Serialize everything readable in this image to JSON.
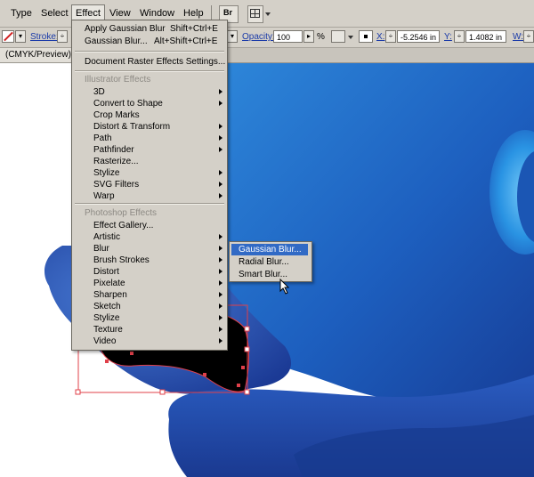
{
  "menubar": {
    "items": [
      "Type",
      "Select",
      "Effect",
      "View",
      "Window",
      "Help"
    ],
    "bridge_label": "Br"
  },
  "controlbar": {
    "stroke_label": "Stroke:",
    "opacity_label": "Opacity:",
    "opacity_value": "100",
    "opacity_unit": "%",
    "x_label": "X:",
    "x_value": "-5.2546 in",
    "y_label": "Y:",
    "y_value": "1.4082 in",
    "w_label": "W:"
  },
  "document": {
    "tab_label": "(CMYK/Preview)"
  },
  "effect_menu": {
    "apply_last": {
      "label": "Apply Gaussian Blur",
      "shortcut": "Shift+Ctrl+E"
    },
    "last_effect": {
      "label": "Gaussian Blur...",
      "shortcut": "Alt+Shift+Ctrl+E"
    },
    "raster_settings": "Document Raster Effects Settings...",
    "illustrator_heading": "Illustrator Effects",
    "illustrator_items": [
      {
        "label": "3D",
        "submenu": true
      },
      {
        "label": "Convert to Shape",
        "submenu": true
      },
      {
        "label": "Crop Marks",
        "submenu": false
      },
      {
        "label": "Distort & Transform",
        "submenu": true
      },
      {
        "label": "Path",
        "submenu": true
      },
      {
        "label": "Pathfinder",
        "submenu": true
      },
      {
        "label": "Rasterize...",
        "submenu": false
      },
      {
        "label": "Stylize",
        "submenu": true
      },
      {
        "label": "SVG Filters",
        "submenu": true
      },
      {
        "label": "Warp",
        "submenu": true
      }
    ],
    "photoshop_heading": "Photoshop Effects",
    "photoshop_items": [
      {
        "label": "Effect Gallery...",
        "submenu": false
      },
      {
        "label": "Artistic",
        "submenu": true
      },
      {
        "label": "Blur",
        "submenu": true
      },
      {
        "label": "Brush Strokes",
        "submenu": true
      },
      {
        "label": "Distort",
        "submenu": true
      },
      {
        "label": "Pixelate",
        "submenu": true
      },
      {
        "label": "Sharpen",
        "submenu": true
      },
      {
        "label": "Sketch",
        "submenu": true
      },
      {
        "label": "Stylize",
        "submenu": true
      },
      {
        "label": "Texture",
        "submenu": true
      },
      {
        "label": "Video",
        "submenu": true
      }
    ]
  },
  "blur_submenu": {
    "items": [
      "Gaussian Blur...",
      "Radial Blur...",
      "Smart Blur..."
    ],
    "highlighted": "Gaussian Blur..."
  },
  "colors": {
    "chrome": "#d4d0c8",
    "highlight": "#316ac5",
    "artwork_blue": "#1e63c4",
    "selection": "#e0404a"
  }
}
